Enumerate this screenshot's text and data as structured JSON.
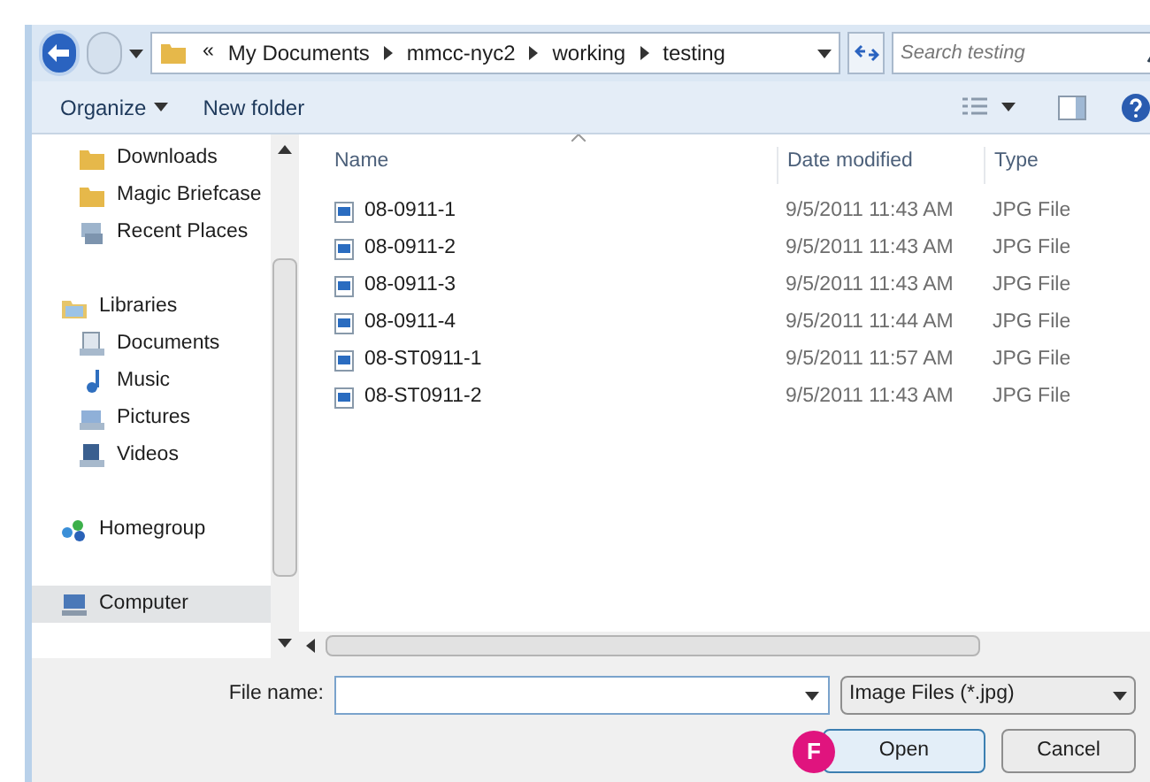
{
  "address_bar": {
    "overflow": "«",
    "path": [
      "My Documents",
      "mmcc-nyc2",
      "working",
      "testing"
    ]
  },
  "search": {
    "placeholder": "Search testing"
  },
  "toolbar": {
    "organize": "Organize",
    "new_folder": "New folder"
  },
  "sidebar": {
    "groups": [
      {
        "items": [
          {
            "label": "Downloads",
            "kind": "folder",
            "selected": false
          },
          {
            "label": "Magic Briefcase",
            "kind": "folder",
            "selected": false
          },
          {
            "label": "Recent Places",
            "kind": "recent",
            "selected": false
          }
        ]
      },
      {
        "items": [
          {
            "label": "Libraries",
            "kind": "library",
            "selected": false,
            "children": [
              {
                "label": "Documents",
                "kind": "document",
                "selected": false
              },
              {
                "label": "Music",
                "kind": "music",
                "selected": false
              },
              {
                "label": "Pictures",
                "kind": "picture",
                "selected": false
              },
              {
                "label": "Videos",
                "kind": "video",
                "selected": false
              }
            ]
          }
        ]
      },
      {
        "items": [
          {
            "label": "Homegroup",
            "kind": "homegroup",
            "selected": false
          }
        ]
      },
      {
        "items": [
          {
            "label": "Computer",
            "kind": "computer",
            "selected": true
          }
        ]
      }
    ]
  },
  "table": {
    "columns": [
      "Name",
      "Date modified",
      "Type"
    ],
    "rows": [
      [
        "08-0911-1",
        "9/5/2011 11:43 AM",
        "JPG File"
      ],
      [
        "08-0911-2",
        "9/5/2011 11:43 AM",
        "JPG File"
      ],
      [
        "08-0911-3",
        "9/5/2011 11:43 AM",
        "JPG File"
      ],
      [
        "08-0911-4",
        "9/5/2011 11:44 AM",
        "JPG File"
      ],
      [
        "08-ST0911-1",
        "9/5/2011 11:57 AM",
        "JPG File"
      ],
      [
        "08-ST0911-2",
        "9/5/2011 11:43 AM",
        "JPG File"
      ]
    ]
  },
  "file_name": {
    "label": "File name:"
  },
  "file_type": {
    "value": "Image Files (*.jpg)"
  },
  "buttons": {
    "open": "Open",
    "cancel": "Cancel"
  },
  "callout": {
    "label": "F"
  }
}
